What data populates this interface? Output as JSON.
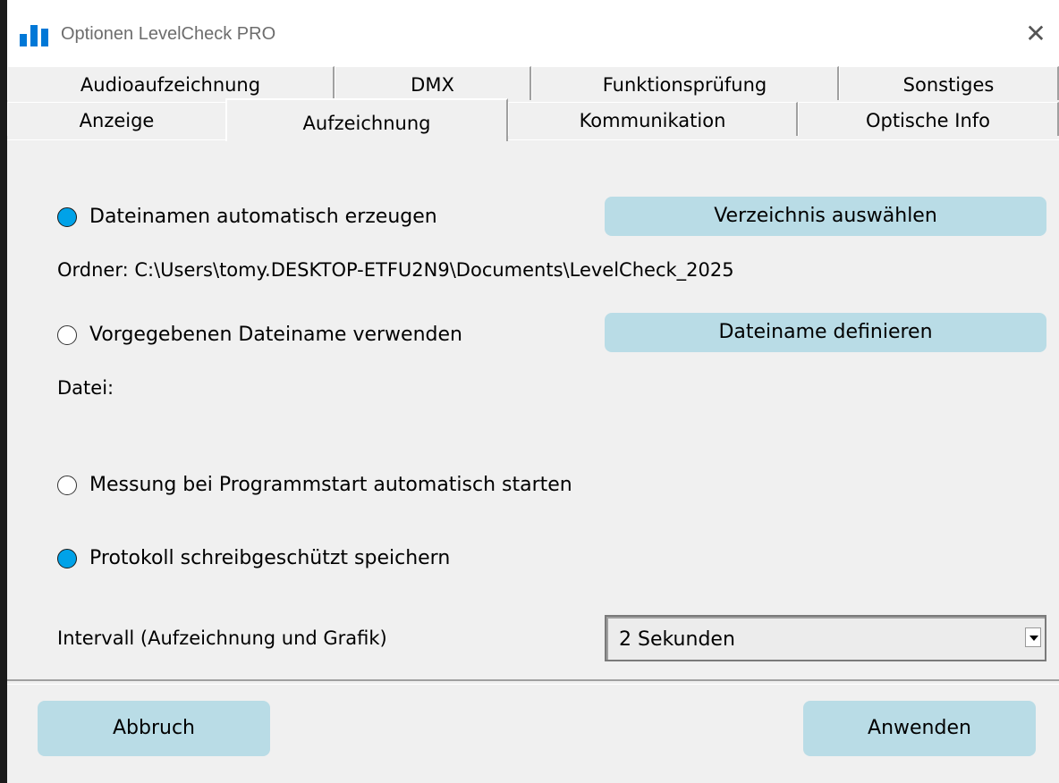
{
  "window": {
    "title": "Optionen LevelCheck PRO",
    "close_glyph": "✕",
    "app_icon": "bar-chart-icon"
  },
  "tabs": {
    "row_top": [
      "Audioaufzeichnung",
      "DMX",
      "Funktionsprüfung",
      "Sonstiges"
    ],
    "row_bottom": [
      "Anzeige",
      "Aufzeichnung",
      "Kommunikation",
      "Optische Info"
    ],
    "active": "Aufzeichnung"
  },
  "options": {
    "auto_filename": {
      "label": "Dateinamen automatisch erzeugen",
      "checked": true
    },
    "choose_dir_button": "Verzeichnis auswählen",
    "folder_text": "Ordner: C:\\Users\\tomy.DESKTOP-ETFU2N9\\Documents\\LevelCheck_2025",
    "given_filename": {
      "label": "Vorgegebenen Dateiname verwenden",
      "checked": false
    },
    "define_filename_button": "Dateiname definieren",
    "file_text": "Datei:",
    "autostart": {
      "label": "Messung bei Programmstart automatisch starten",
      "checked": false
    },
    "readonly_log": {
      "label": "Protokoll schreibgeschützt speichern",
      "checked": true
    },
    "interval_label": "Intervall (Aufzeichnung und Grafik)",
    "interval_value": "2 Sekunden"
  },
  "footer": {
    "cancel": "Abbruch",
    "apply": "Anwenden"
  },
  "colors": {
    "radio_checked": "#00a2e8",
    "button_bg": "#b9dce6",
    "dialog_bg": "#f0f0f0"
  }
}
